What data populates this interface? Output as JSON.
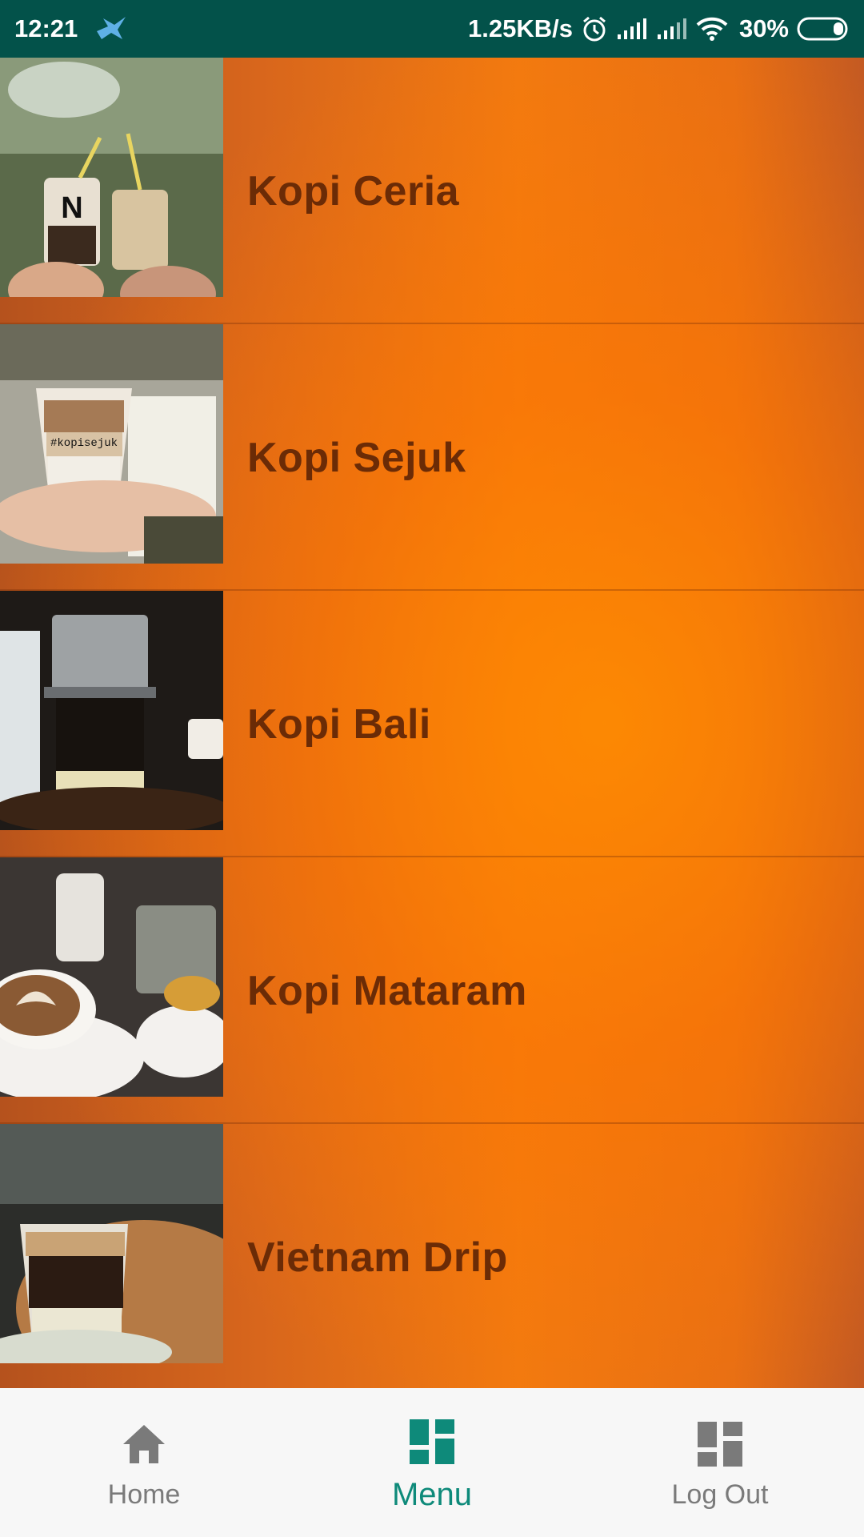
{
  "status_bar": {
    "time": "12:21",
    "net_speed": "1.25KB/s",
    "battery": "30%"
  },
  "menu": {
    "items": [
      {
        "label": "Kopi Ceria",
        "thumb_icon": "iced-coffee-cups-photo"
      },
      {
        "label": "Kopi Sejuk",
        "thumb_icon": "layered-iced-coffee-photo"
      },
      {
        "label": "Kopi Bali",
        "thumb_icon": "drip-coffee-filter-photo"
      },
      {
        "label": "Kopi Mataram",
        "thumb_icon": "latte-art-cup-photo"
      },
      {
        "label": "Vietnam Drip",
        "thumb_icon": "vietnam-drip-glass-photo"
      }
    ]
  },
  "bottom_nav": {
    "home": "Home",
    "menu": "Menu",
    "logout": "Log Out",
    "active": "menu",
    "active_color": "#0e8a7a",
    "inactive_color": "#7a7a7a"
  }
}
